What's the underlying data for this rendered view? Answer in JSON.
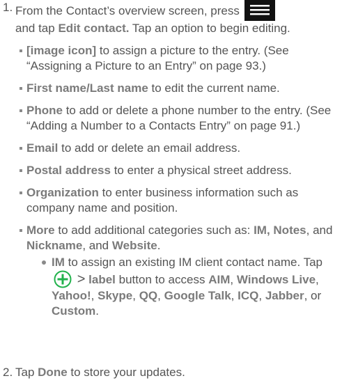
{
  "step1": {
    "number": "1.",
    "text_before_icon": "From the Contact’s overview screen, press",
    "text_after_icon": "and tap",
    "edit_contact": "Edit contact.",
    "text_end": "Tap an option to begin editing."
  },
  "menu_key_icon": "menu-key-icon",
  "items": [
    {
      "bold": "[image icon]",
      "text": "to assign a picture to the entry. (See “Assigning a Picture to an Entry” on page 93.)"
    },
    {
      "bold": "First name/Last name",
      "text": "to edit the current name."
    },
    {
      "bold": "Phone",
      "text": "to add or delete a phone number to the entry. (See “Adding a Number to a Contacts Entry” on page 91.)"
    },
    {
      "bold": "Email",
      "text": "to add or delete an email address."
    },
    {
      "bold": "Postal address",
      "text": "to enter a physical street address."
    },
    {
      "bold": "Organization",
      "text": "to enter business information such as company name and position."
    }
  ],
  "more": {
    "bold": "More",
    "text": "to add additional categories such as:",
    "im": "IM,",
    "notes": "Notes",
    "nickname": "Nickname",
    "and": ", and",
    "website": "Website",
    "period": "."
  },
  "im_item": {
    "bold": "IM",
    "text1": "to assign an existing IM client contact name. Tap",
    "plus_icon": "plus-circle-icon",
    "gt": ">",
    "label": "label",
    "text2": "button to access",
    "aim": "AIM",
    "windows_live": "Windows Live",
    "yahoo": "Yahoo!",
    "skype": "Skype",
    "qq": "QQ",
    "google_talk": "Google Talk",
    "icq": "ICQ",
    "jabber": "Jabber",
    "or": ", or",
    "custom": "Custom",
    "comma": ",",
    "period": "."
  },
  "step2": {
    "number": "2.",
    "text1": "Tap",
    "done": "Done",
    "text2": "to store your updates."
  },
  "colors": {
    "text": "#555555",
    "bold": "#7a7a7a",
    "plus_green": "#22b24c",
    "menu_key": "#111111"
  }
}
